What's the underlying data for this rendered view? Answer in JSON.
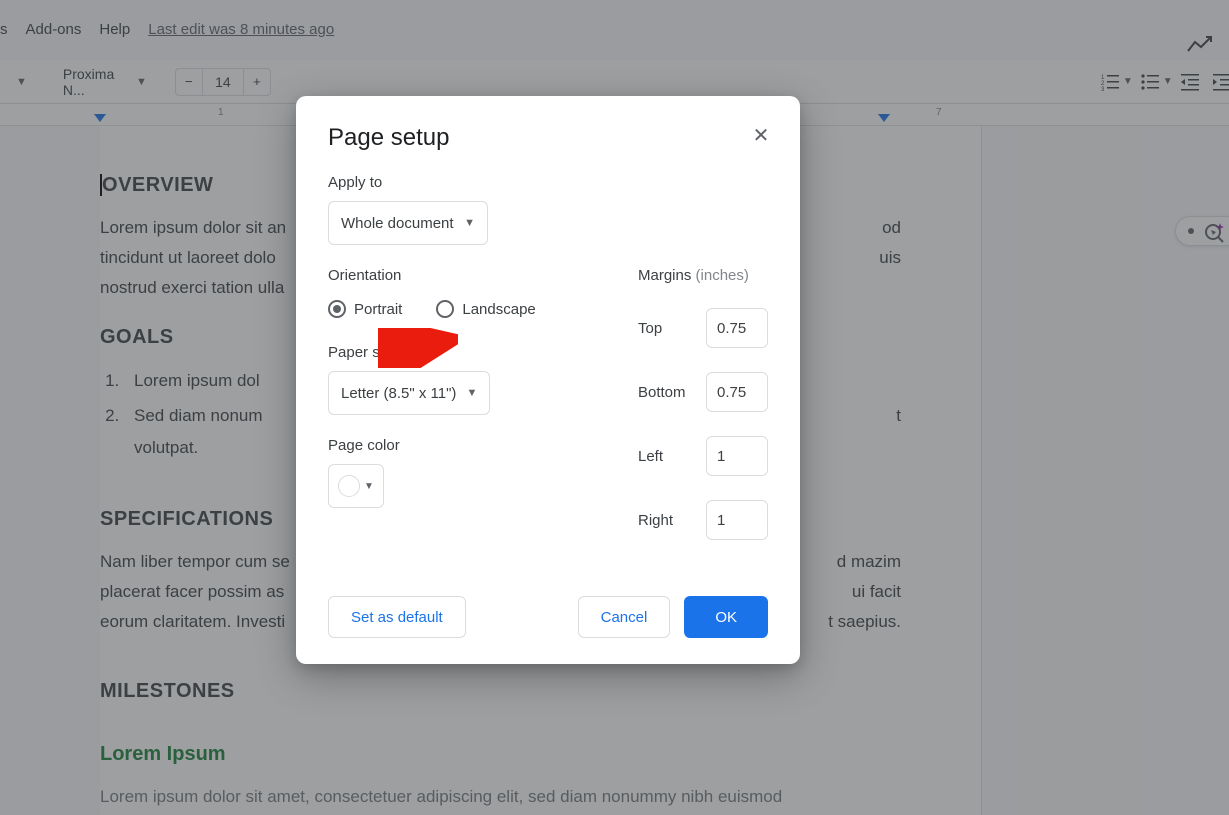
{
  "menubar": {
    "items": [
      "s",
      "Add-ons",
      "Help"
    ],
    "edit_status": "Last edit was 8 minutes ago"
  },
  "toolbar": {
    "font_name": "Proxima N...",
    "font_size": "14",
    "icons": {
      "decrease": "−",
      "increase": "+"
    }
  },
  "ruler": {
    "marks": {
      "m1": "1",
      "m7": "7"
    }
  },
  "document": {
    "h_overview": "OVERVIEW",
    "h_overview_first": "O",
    "h_overview_rest": "VERVIEW",
    "p_overview_l1": "Lorem ipsum dolor sit an",
    "p_overview_l2": "tincidunt ut laoreet dolo",
    "p_overview_l3": "nostrud exerci tation ulla",
    "p_overview_r1": "od",
    "p_overview_r2": "uis",
    "h_goals": "GOALS",
    "goal_1": "Lorem ipsum dol",
    "goal_2a": "Sed diam nonum",
    "goal_2b": "volutpat.",
    "goal_2_right": "t",
    "h_specs": "SPECIFICATIONS",
    "p_specs_l1": "Nam liber tempor cum se",
    "p_specs_l2": "placerat facer possim as",
    "p_specs_l3": "eorum claritatem. Investi",
    "p_specs_r1": "d mazim",
    "p_specs_r2": "ui facit",
    "p_specs_r3": "t saepius.",
    "h_milestones": "MILESTONES",
    "h_lorem": "Lorem Ipsum",
    "p_final": "Lorem ipsum dolor sit amet, consectetuer adipiscing elit, sed diam nonummy nibh euismod"
  },
  "dialog": {
    "title": "Page setup",
    "apply_to_label": "Apply to",
    "apply_to_value": "Whole document",
    "orientation_label": "Orientation",
    "portrait": "Portrait",
    "landscape": "Landscape",
    "paper_size_label": "Paper size",
    "paper_size_value": "Letter (8.5\" x 11\")",
    "page_color_label": "Page color",
    "margins_label": "Margins",
    "margins_unit": "(inches)",
    "margin_top_label": "Top",
    "margin_top_value": "0.75",
    "margin_bottom_label": "Bottom",
    "margin_bottom_value": "0.75",
    "margin_left_label": "Left",
    "margin_left_value": "1",
    "margin_right_label": "Right",
    "margin_right_value": "1",
    "set_default": "Set as default",
    "cancel": "Cancel",
    "ok": "OK"
  }
}
